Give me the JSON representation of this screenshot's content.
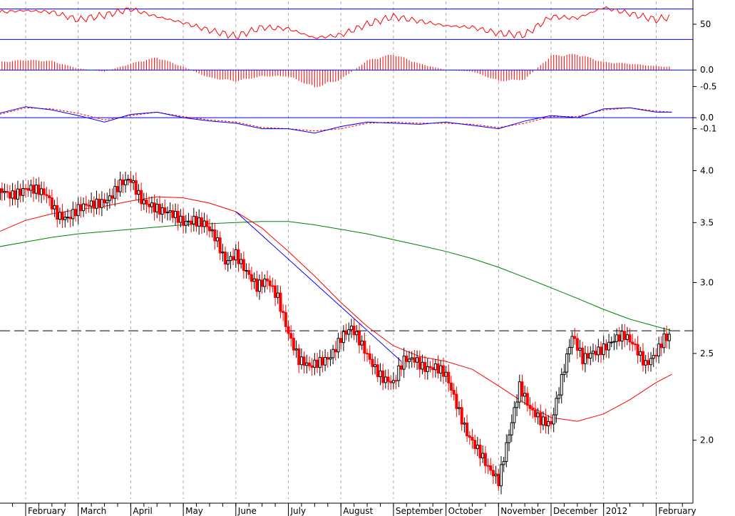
{
  "chart_data": {
    "type": "line",
    "title": "",
    "colors": {
      "price_up": "#000000",
      "price_down": "#ff0000",
      "ma_short": "#ff0000",
      "ma_long": "#008000",
      "trendline": "#0000ff",
      "reference": "#0000ff",
      "macd": "#0000ff",
      "signal": "#ff0000",
      "histogram": "#ff0000",
      "rsi": "#ff0000",
      "grid": "#aaaaaa"
    },
    "price_scale": "log",
    "x_labels": [
      "February",
      "March",
      "April",
      "May",
      "June",
      "July",
      "August",
      "September",
      "October",
      "November",
      "December",
      "2012",
      "February"
    ],
    "month_index": [
      0.0,
      1.0,
      2.0,
      3.0,
      4.0,
      5.0,
      6.0,
      7.0,
      8.0,
      9.0,
      10.0,
      11.0,
      12.0
    ],
    "rsi_panel": {
      "ticks": [
        "50"
      ],
      "tick_values": [
        50
      ],
      "levels": [
        70,
        30
      ],
      "ylim": [
        20,
        80
      ],
      "x": [
        -0.9,
        -0.5,
        0,
        0.5,
        1,
        1.5,
        2,
        2.5,
        3,
        3.5,
        4,
        4.5,
        5,
        5.5,
        6,
        6.5,
        7,
        7.5,
        8,
        8.5,
        9,
        9.5,
        10,
        10.5,
        11,
        11.5,
        12,
        12.3
      ],
      "values": [
        60,
        66,
        68,
        66,
        56,
        62,
        70,
        60,
        52,
        42,
        34,
        46,
        44,
        32,
        36,
        50,
        60,
        54,
        48,
        46,
        38,
        36,
        60,
        58,
        72,
        64,
        56,
        60
      ]
    },
    "histogram_panel": {
      "ticks": [
        "0.0",
        "-0.5"
      ],
      "tick_values": [
        0.0,
        -0.5
      ],
      "ylim": [
        -0.9,
        0.65
      ],
      "x": [
        -0.9,
        -0.5,
        0,
        0.5,
        1,
        1.5,
        2,
        2.5,
        3,
        3.5,
        4,
        4.5,
        5,
        5.5,
        6,
        6.5,
        7,
        7.5,
        8,
        8.5,
        9,
        9.5,
        10,
        10.5,
        11,
        11.5,
        12,
        12.3
      ],
      "values": [
        0.1,
        0.25,
        0.32,
        0.28,
        0.05,
        -0.05,
        0.2,
        0.4,
        0.1,
        -0.25,
        -0.35,
        -0.2,
        -0.2,
        -0.55,
        -0.3,
        0.3,
        0.5,
        0.2,
        0.0,
        -0.05,
        -0.35,
        -0.3,
        0.45,
        0.5,
        0.25,
        0.2,
        0.12,
        0.1
      ]
    },
    "macd_panel": {
      "ticks": [
        "0.0",
        "-0.1"
      ],
      "tick_values": [
        0.0,
        -0.1
      ],
      "ylim": [
        -0.2,
        0.15
      ],
      "x": [
        -0.9,
        -0.5,
        0,
        0.5,
        1,
        1.5,
        2,
        2.5,
        3,
        3.5,
        4,
        4.5,
        5,
        5.5,
        6,
        6.5,
        7,
        7.5,
        8,
        8.5,
        9,
        9.5,
        10,
        10.5,
        11,
        11.5,
        12,
        12.3
      ],
      "macd": [
        0.0,
        0.04,
        0.1,
        0.07,
        0.02,
        -0.04,
        0.03,
        0.05,
        0.0,
        -0.03,
        -0.05,
        -0.1,
        -0.1,
        -0.14,
        -0.08,
        -0.04,
        -0.05,
        -0.06,
        -0.04,
        -0.07,
        -0.1,
        -0.03,
        0.02,
        0.0,
        0.08,
        0.09,
        0.05,
        0.05
      ],
      "signal": [
        0.0,
        0.03,
        0.09,
        0.08,
        0.04,
        -0.02,
        0.02,
        0.05,
        0.01,
        -0.02,
        -0.04,
        -0.09,
        -0.1,
        -0.12,
        -0.1,
        -0.05,
        -0.04,
        -0.05,
        -0.05,
        -0.06,
        -0.09,
        -0.05,
        0.01,
        0.01,
        0.07,
        0.09,
        0.06,
        0.05
      ]
    },
    "price_panel": {
      "ticks": [
        "4.0",
        "3.5",
        "3.0",
        "2.5",
        "2.0"
      ],
      "tick_values": [
        4.0,
        3.5,
        3.0,
        2.5,
        2.0
      ],
      "ylim": [
        1.72,
        4.3
      ],
      "reference_level": 2.65,
      "close_x": [
        -0.9,
        -0.75,
        -0.6,
        -0.45,
        -0.3,
        -0.15,
        0.0,
        0.2,
        0.4,
        0.6,
        0.8,
        1.0,
        1.2,
        1.4,
        1.6,
        1.8,
        2.0,
        2.2,
        2.4,
        2.6,
        2.8,
        3.0,
        3.2,
        3.4,
        3.6,
        3.8,
        4.0,
        4.2,
        4.4,
        4.6,
        4.8,
        5.0,
        5.2,
        5.4,
        5.6,
        5.8,
        6.0,
        6.2,
        6.4,
        6.6,
        6.8,
        7.0,
        7.2,
        7.4,
        7.6,
        7.8,
        8.0,
        8.2,
        8.4,
        8.6,
        8.8,
        9.0,
        9.2,
        9.4,
        9.6,
        9.8,
        10.0,
        10.2,
        10.4,
        10.6,
        10.8,
        11.0,
        11.2,
        11.4,
        11.6,
        11.8,
        12.0,
        12.15,
        12.3
      ],
      "close": [
        3.3,
        3.45,
        3.7,
        3.8,
        3.78,
        3.8,
        3.82,
        3.78,
        3.75,
        3.6,
        3.55,
        3.6,
        3.65,
        3.7,
        3.75,
        3.85,
        3.88,
        3.72,
        3.68,
        3.6,
        3.55,
        3.5,
        3.55,
        3.5,
        3.35,
        3.15,
        3.25,
        3.1,
        2.95,
        3.0,
        2.9,
        2.65,
        2.45,
        2.4,
        2.45,
        2.5,
        2.6,
        2.65,
        2.55,
        2.45,
        2.35,
        2.3,
        2.45,
        2.48,
        2.42,
        2.4,
        2.35,
        2.2,
        2.05,
        1.95,
        1.85,
        1.8,
        2.05,
        2.3,
        2.15,
        2.1,
        2.1,
        2.35,
        2.6,
        2.45,
        2.52,
        2.55,
        2.58,
        2.6,
        2.55,
        2.45,
        2.5,
        2.58,
        2.6
      ],
      "ma_short_x": [
        -0.9,
        -0.5,
        0.0,
        0.5,
        1.0,
        1.5,
        2.0,
        2.5,
        3.0,
        3.5,
        4.0,
        4.5,
        5.0,
        5.5,
        6.0,
        6.5,
        7.0,
        7.5,
        8.0,
        8.5,
        9.0,
        9.5,
        10.0,
        10.5,
        11.0,
        11.5,
        12.0,
        12.3
      ],
      "ma_short": [
        3.32,
        3.42,
        3.52,
        3.58,
        3.62,
        3.65,
        3.7,
        3.74,
        3.73,
        3.68,
        3.6,
        3.45,
        3.25,
        3.05,
        2.85,
        2.68,
        2.55,
        2.48,
        2.45,
        2.4,
        2.3,
        2.2,
        2.12,
        2.1,
        2.14,
        2.22,
        2.32,
        2.37
      ],
      "ma_long_x": [
        -0.9,
        -0.5,
        0.0,
        0.5,
        1.0,
        1.5,
        2.0,
        2.5,
        3.0,
        3.5,
        4.0,
        4.5,
        5.0,
        5.5,
        6.0,
        6.5,
        7.0,
        7.5,
        8.0,
        8.5,
        9.0,
        9.5,
        10.0,
        10.5,
        11.0,
        11.5,
        12.0,
        12.3
      ],
      "ma_long": [
        3.28,
        3.29,
        3.33,
        3.37,
        3.4,
        3.42,
        3.44,
        3.46,
        3.48,
        3.49,
        3.5,
        3.51,
        3.51,
        3.48,
        3.44,
        3.4,
        3.35,
        3.3,
        3.25,
        3.19,
        3.12,
        3.04,
        2.96,
        2.88,
        2.8,
        2.73,
        2.68,
        2.65
      ],
      "trendline": {
        "x": [
          4.0,
          7.15
        ],
        "y": [
          3.6,
          2.45
        ]
      }
    }
  }
}
